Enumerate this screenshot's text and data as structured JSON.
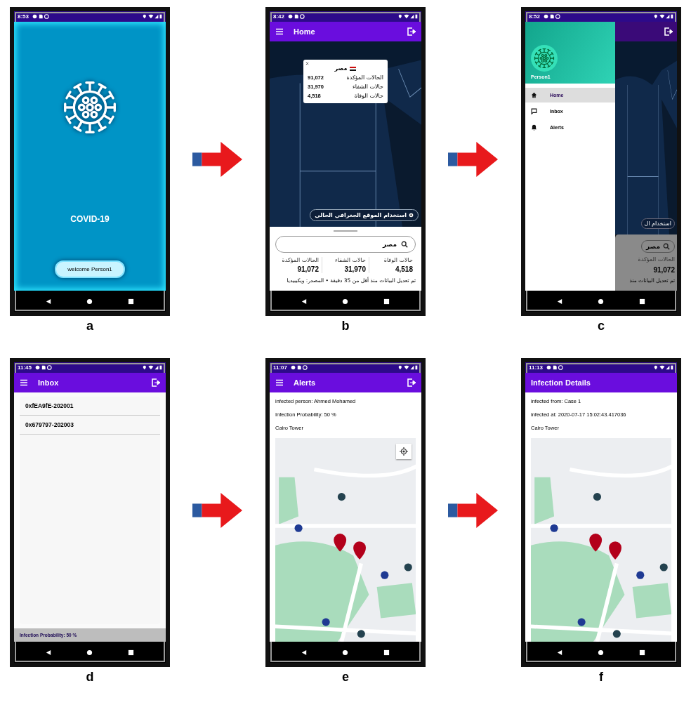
{
  "panel_a": {
    "letter": "a",
    "kind": "splash",
    "status_time": "8:53",
    "title": "COVID-19",
    "button": "welcome Person1"
  },
  "panel_b": {
    "letter": "b",
    "kind": "home",
    "status_time": "8:42",
    "app_bar": {
      "title": "Home",
      "menu": true,
      "logout": true
    },
    "popup": {
      "country": "مصر",
      "rows": [
        {
          "value": "91,072",
          "label": "الحالات المؤكدة"
        },
        {
          "value": "31,970",
          "label": "حالات الشفاء"
        },
        {
          "value": "4,518",
          "label": "حالات الوفاة"
        }
      ]
    },
    "location_button": "استخدام الموقع الجغرافي الحالي",
    "search": {
      "value": "مصر"
    },
    "stats": [
      {
        "label": "حالات الوفاة",
        "value": "4,518"
      },
      {
        "label": "حالات الشفاء",
        "value": "31,970"
      },
      {
        "label": "الحالات المؤكدة",
        "value": "91,072"
      }
    ],
    "note": "تم تعديل البيانات منذ أقل من 35 دقيقة • المصدر: ويكيبيديا"
  },
  "panel_c": {
    "letter": "c",
    "kind": "drawer",
    "status_time": "8:52",
    "user": "Person1",
    "items": [
      {
        "kind": "home",
        "label": "Home",
        "selected": true
      },
      {
        "kind": "inbox",
        "label": "Inbox",
        "selected": false
      },
      {
        "kind": "alerts",
        "label": "Alerts",
        "selected": false
      }
    ],
    "behind": {
      "location_button": "استخدام ال",
      "search": {
        "value": "مصر"
      },
      "stat": {
        "label": "الحالات المؤكدة",
        "value": "91,072"
      },
      "note": "تم تعديل البيانات منذ"
    }
  },
  "panel_d": {
    "letter": "d",
    "kind": "inbox",
    "status_time": "11:45",
    "app_bar": {
      "title": "Inbox",
      "menu": true,
      "logout": true
    },
    "items": [
      "0xfEA9fE-202001",
      "0x679797-202003"
    ],
    "snackbar": "Infection Probability: 50 %"
  },
  "panel_e": {
    "letter": "e",
    "kind": "details",
    "status_time": "11:07",
    "app_bar": {
      "title": "Alerts",
      "menu": true,
      "logout": true
    },
    "lines": [
      "infected person: Ahmed Mohamed",
      "Infection Probability: 50 %",
      "Cairo Tower"
    ],
    "map": {
      "locate_button": true
    }
  },
  "panel_f": {
    "letter": "f",
    "kind": "details",
    "status_time": "11:13",
    "app_bar": {
      "title": "Infection Details",
      "menu": false,
      "logout": false
    },
    "lines": [
      "infected from: Case 1",
      "infected at: 2020-07-17 15:02:43.417036",
      "Cairo Tower"
    ],
    "map": {
      "locate_button": false
    }
  }
}
